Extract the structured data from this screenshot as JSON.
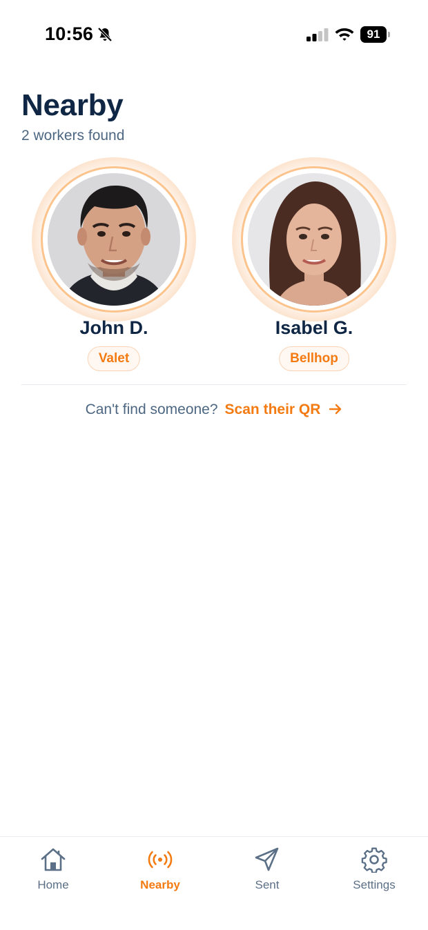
{
  "status_bar": {
    "time": "10:56",
    "battery": "91",
    "icons": [
      "bell-slash-icon",
      "signal-icon",
      "wifi-icon",
      "battery-icon"
    ]
  },
  "header": {
    "title": "Nearby",
    "subtitle": "2 workers found"
  },
  "workers": [
    {
      "name": "John D.",
      "role": "Valet"
    },
    {
      "name": "Isabel G.",
      "role": "Bellhop"
    }
  ],
  "scan": {
    "prompt": "Can't find someone?",
    "link_label": "Scan their QR"
  },
  "nav": {
    "items": [
      {
        "label": "Home",
        "icon": "home-icon",
        "active": false
      },
      {
        "label": "Nearby",
        "icon": "broadcast-icon",
        "active": true
      },
      {
        "label": "Sent",
        "icon": "paper-plane-icon",
        "active": false
      },
      {
        "label": "Settings",
        "icon": "gear-icon",
        "active": false
      }
    ]
  },
  "colors": {
    "accent": "#f47a12",
    "title": "#0f2744",
    "muted": "#4d6782",
    "badge_border": "#fbd3b4",
    "ring": "#fcc48c"
  }
}
